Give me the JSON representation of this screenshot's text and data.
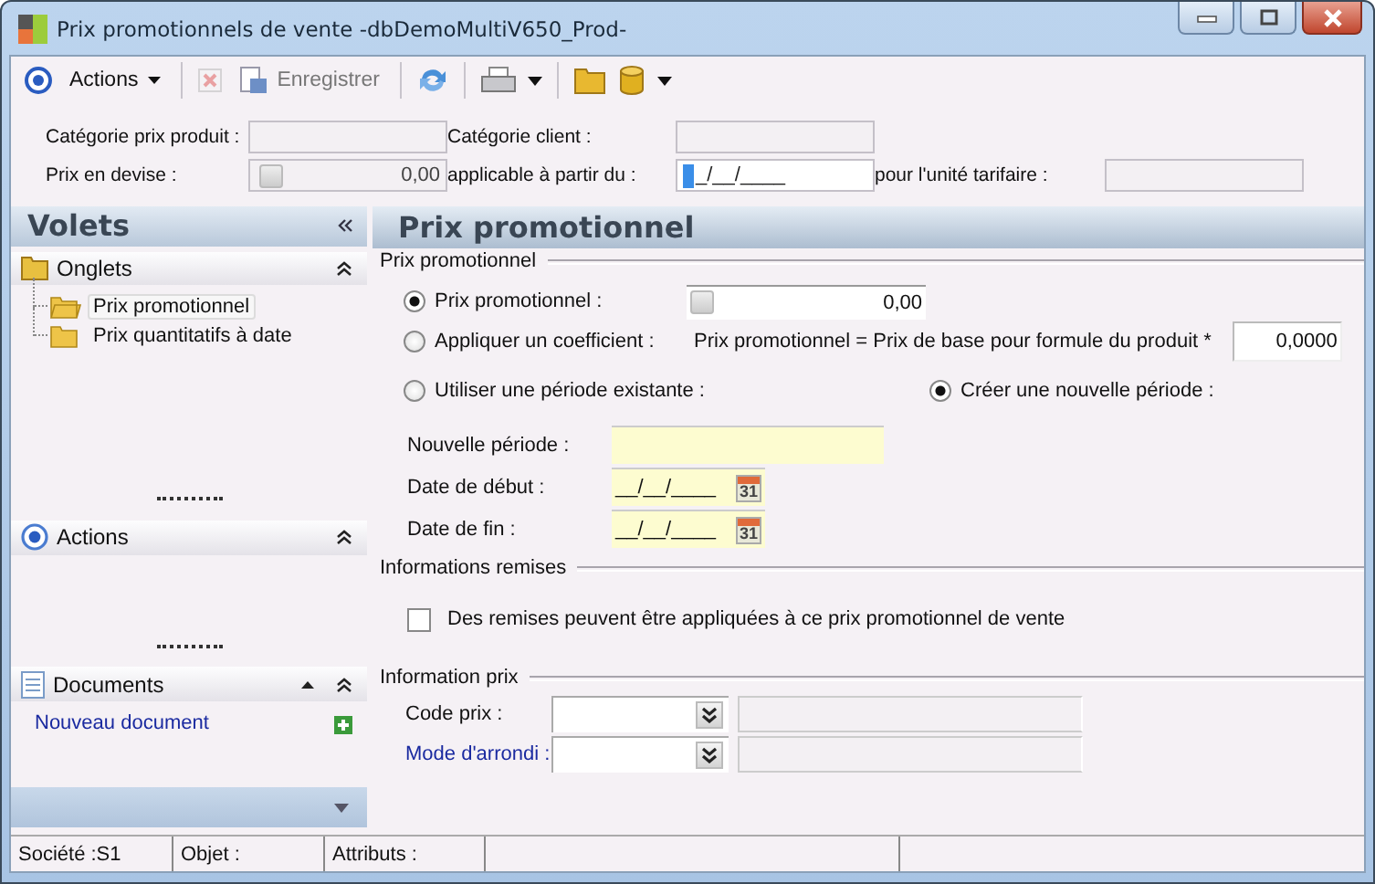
{
  "window": {
    "title": "Prix promotionnels de vente -dbDemoMultiV650_Prod-"
  },
  "toolbar": {
    "actions_label": "Actions",
    "save_label": "Enregistrer",
    "save_disabled": true,
    "delete_disabled": true
  },
  "header_fields": [
    {
      "label": "Catégorie prix produit :",
      "kind": "text"
    },
    {
      "label": "Catégorie client :",
      "kind": "text"
    },
    {
      "kind": "spacer"
    },
    {
      "label": "Prix en devise :",
      "kind": "amount",
      "value": "0,00"
    },
    {
      "label": "applicable à partir du :",
      "kind": "date",
      "value": "_/__/____",
      "focused": true
    },
    {
      "label": "pour l'unité tarifaire :",
      "kind": "text"
    }
  ],
  "sidebar": {
    "title": "Volets",
    "sections": [
      {
        "kind": "tabs",
        "title": "Onglets",
        "expanded": true,
        "items": [
          {
            "label": "Prix promotionnel",
            "selected": true
          },
          {
            "label": "Prix quantitatifs à date",
            "selected": false
          }
        ]
      },
      {
        "kind": "actions",
        "title": "Actions",
        "expanded": true
      },
      {
        "kind": "documents",
        "title": "Documents",
        "expanded": true,
        "link": "Nouveau document"
      }
    ]
  },
  "main": {
    "heading": "Prix promotionnel",
    "promo_group": {
      "legend": "Prix promotionnel",
      "price_mode": [
        {
          "label": "Prix promotionnel :",
          "selected": true,
          "value": "0,00"
        },
        {
          "label": "Appliquer un coefficient :",
          "selected": false,
          "formula": "Prix promotionnel = Prix de base pour formule du produit *",
          "value": "0,0000"
        }
      ],
      "period_mode": [
        {
          "label": "Utiliser une période existante :",
          "selected": false
        },
        {
          "label": "Créer une nouvelle période :",
          "selected": true
        }
      ],
      "fields": [
        {
          "label": "Nouvelle période :",
          "kind": "text"
        },
        {
          "label": "Date de début :",
          "kind": "date",
          "value": "__/__/____",
          "calendar_day": "31"
        },
        {
          "label": "Date de fin :",
          "kind": "date",
          "value": "__/__/____",
          "calendar_day": "31"
        }
      ]
    },
    "discount_group": {
      "legend": "Informations remises",
      "checkbox": {
        "label": "Des remises peuvent être appliquées à ce prix promotionnel de vente",
        "checked": false
      }
    },
    "price_info_group": {
      "legend": "Information prix",
      "rows": [
        {
          "label": "Code prix :",
          "link": false
        },
        {
          "label": "Mode d'arrondi :",
          "link": true
        }
      ]
    }
  },
  "status_bar": [
    "Société :S1",
    "Objet :",
    "Attributs :"
  ]
}
